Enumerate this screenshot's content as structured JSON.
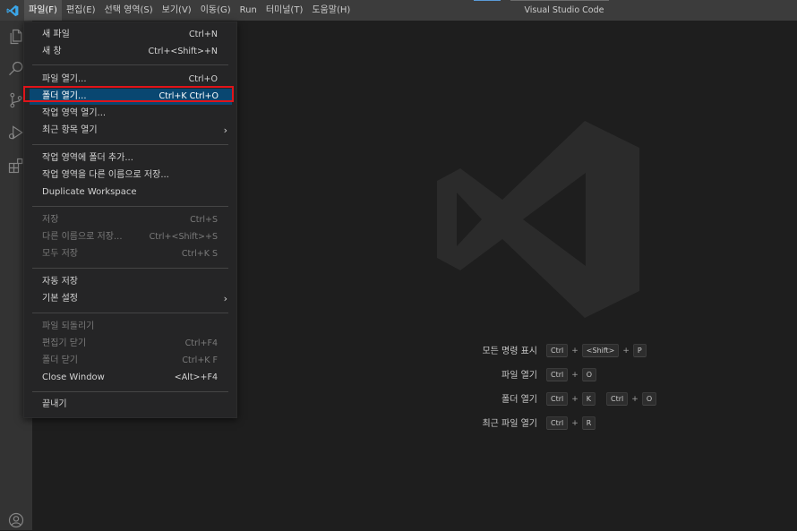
{
  "titlebar": {
    "window_title": "Visual Studio Code",
    "menus": [
      {
        "label": "파일(F)",
        "active": true
      },
      {
        "label": "편집(E)"
      },
      {
        "label": "선택 영역(S)"
      },
      {
        "label": "보기(V)"
      },
      {
        "label": "이동(G)"
      },
      {
        "label": "Run"
      },
      {
        "label": "터미널(T)"
      },
      {
        "label": "도움말(H)"
      }
    ]
  },
  "activitybar": {
    "icons": [
      "explorer-icon",
      "search-icon",
      "source-control-icon",
      "run-debug-icon",
      "extensions-icon",
      "account-icon"
    ]
  },
  "file_menu": {
    "items": [
      {
        "label": "새 파일",
        "shortcut": "Ctrl+N"
      },
      {
        "label": "새 창",
        "shortcut": "Ctrl+<Shift>+N"
      },
      {
        "label": "파일 열기...",
        "shortcut": "Ctrl+O"
      },
      {
        "label": "폴더 열기...",
        "shortcut": "Ctrl+K Ctrl+O",
        "selected": true
      },
      {
        "label": "작업 영역 열기..."
      },
      {
        "label": "최근 항목 열기",
        "submenu": true
      },
      {
        "label": "작업 영역에 폴더 추가..."
      },
      {
        "label": "작업 영역을 다른 이름으로 저장..."
      },
      {
        "label": "Duplicate Workspace"
      },
      {
        "label": "저장",
        "shortcut": "Ctrl+S",
        "disabled": true
      },
      {
        "label": "다른 이름으로 저장...",
        "shortcut": "Ctrl+<Shift>+S",
        "disabled": true
      },
      {
        "label": "모두 저장",
        "shortcut": "Ctrl+K S",
        "disabled": true
      },
      {
        "label": "자동 저장"
      },
      {
        "label": "기본 설정",
        "submenu": true
      },
      {
        "label": "파일 되돌리기",
        "disabled": true
      },
      {
        "label": "편집기 닫기",
        "shortcut": "Ctrl+F4",
        "disabled": true
      },
      {
        "label": "폴더 닫기",
        "shortcut": "Ctrl+K F",
        "disabled": true
      },
      {
        "label": "Close Window",
        "shortcut": "<Alt>+F4"
      },
      {
        "label": "끝내기"
      }
    ]
  },
  "welcome_shortcuts": [
    {
      "label": "모든 명령 표시",
      "keys": [
        "Ctrl",
        "<Shift>",
        "P"
      ]
    },
    {
      "label": "파일 열기",
      "keys": [
        "Ctrl",
        "O"
      ]
    },
    {
      "label": "폴더 열기",
      "keys": [
        "Ctrl",
        "K"
      ],
      "keys2": [
        "Ctrl",
        "O"
      ]
    },
    {
      "label": "최근 파일 열기",
      "keys": [
        "Ctrl",
        "R"
      ]
    }
  ],
  "colors": {
    "titlebar": "#3c3c3c",
    "activitybar": "#333333",
    "editor": "#1e1e1e",
    "menu_bg": "#252526",
    "menu_selection": "#094771",
    "highlight_outline": "#e0141a"
  }
}
